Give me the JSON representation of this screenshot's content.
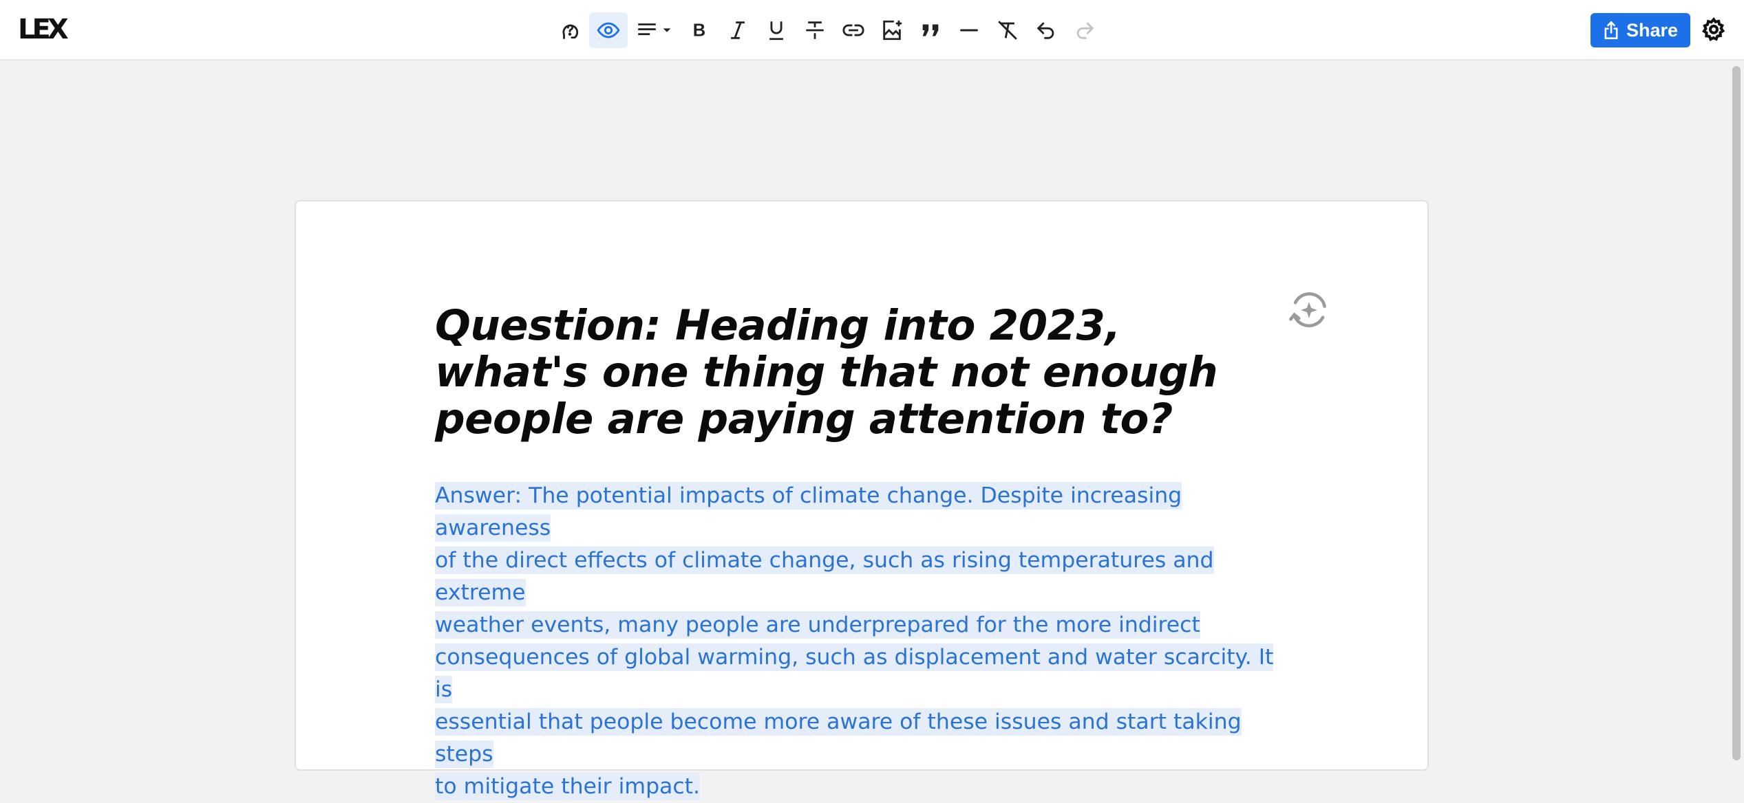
{
  "app": {
    "logo": "LEX"
  },
  "toolbar": {
    "buttons": [
      {
        "name": "ask-question-icon",
        "active": false
      },
      {
        "name": "eye-icon",
        "active": true
      },
      {
        "name": "align-left-icon",
        "active": false,
        "dropdown": true
      },
      {
        "name": "bold-icon",
        "active": false
      },
      {
        "name": "italic-icon",
        "active": false
      },
      {
        "name": "underline-icon",
        "active": false
      },
      {
        "name": "strikethrough-icon",
        "active": false
      },
      {
        "name": "link-icon",
        "active": false
      },
      {
        "name": "insert-image-icon",
        "active": false
      },
      {
        "name": "quote-icon",
        "active": false
      },
      {
        "name": "horizontal-rule-icon",
        "active": false
      },
      {
        "name": "clear-formatting-icon",
        "active": false
      },
      {
        "name": "undo-icon",
        "active": false
      },
      {
        "name": "redo-icon",
        "active": false,
        "disabled": true
      }
    ],
    "share_label": "Share"
  },
  "document": {
    "title": "Question: Heading into 2023, what's one thing that not enough people are paying attention to?",
    "answer_lines": [
      "Answer: The potential impacts of climate change. Despite increasing awareness",
      "of the direct effects of climate change, such as rising temperatures and extreme",
      "weather events, many people are underprepared for the more indirect",
      "consequences of global warming, such as displacement and water scarcity. It is",
      "essential that people become more aware of these issues and start taking steps",
      "to mitigate their impact."
    ]
  },
  "colors": {
    "accent": "#1d71e8",
    "selection_bg": "#e4edf9",
    "selection_text": "#2a73d6",
    "canvas_bg": "#f2f2f2"
  }
}
